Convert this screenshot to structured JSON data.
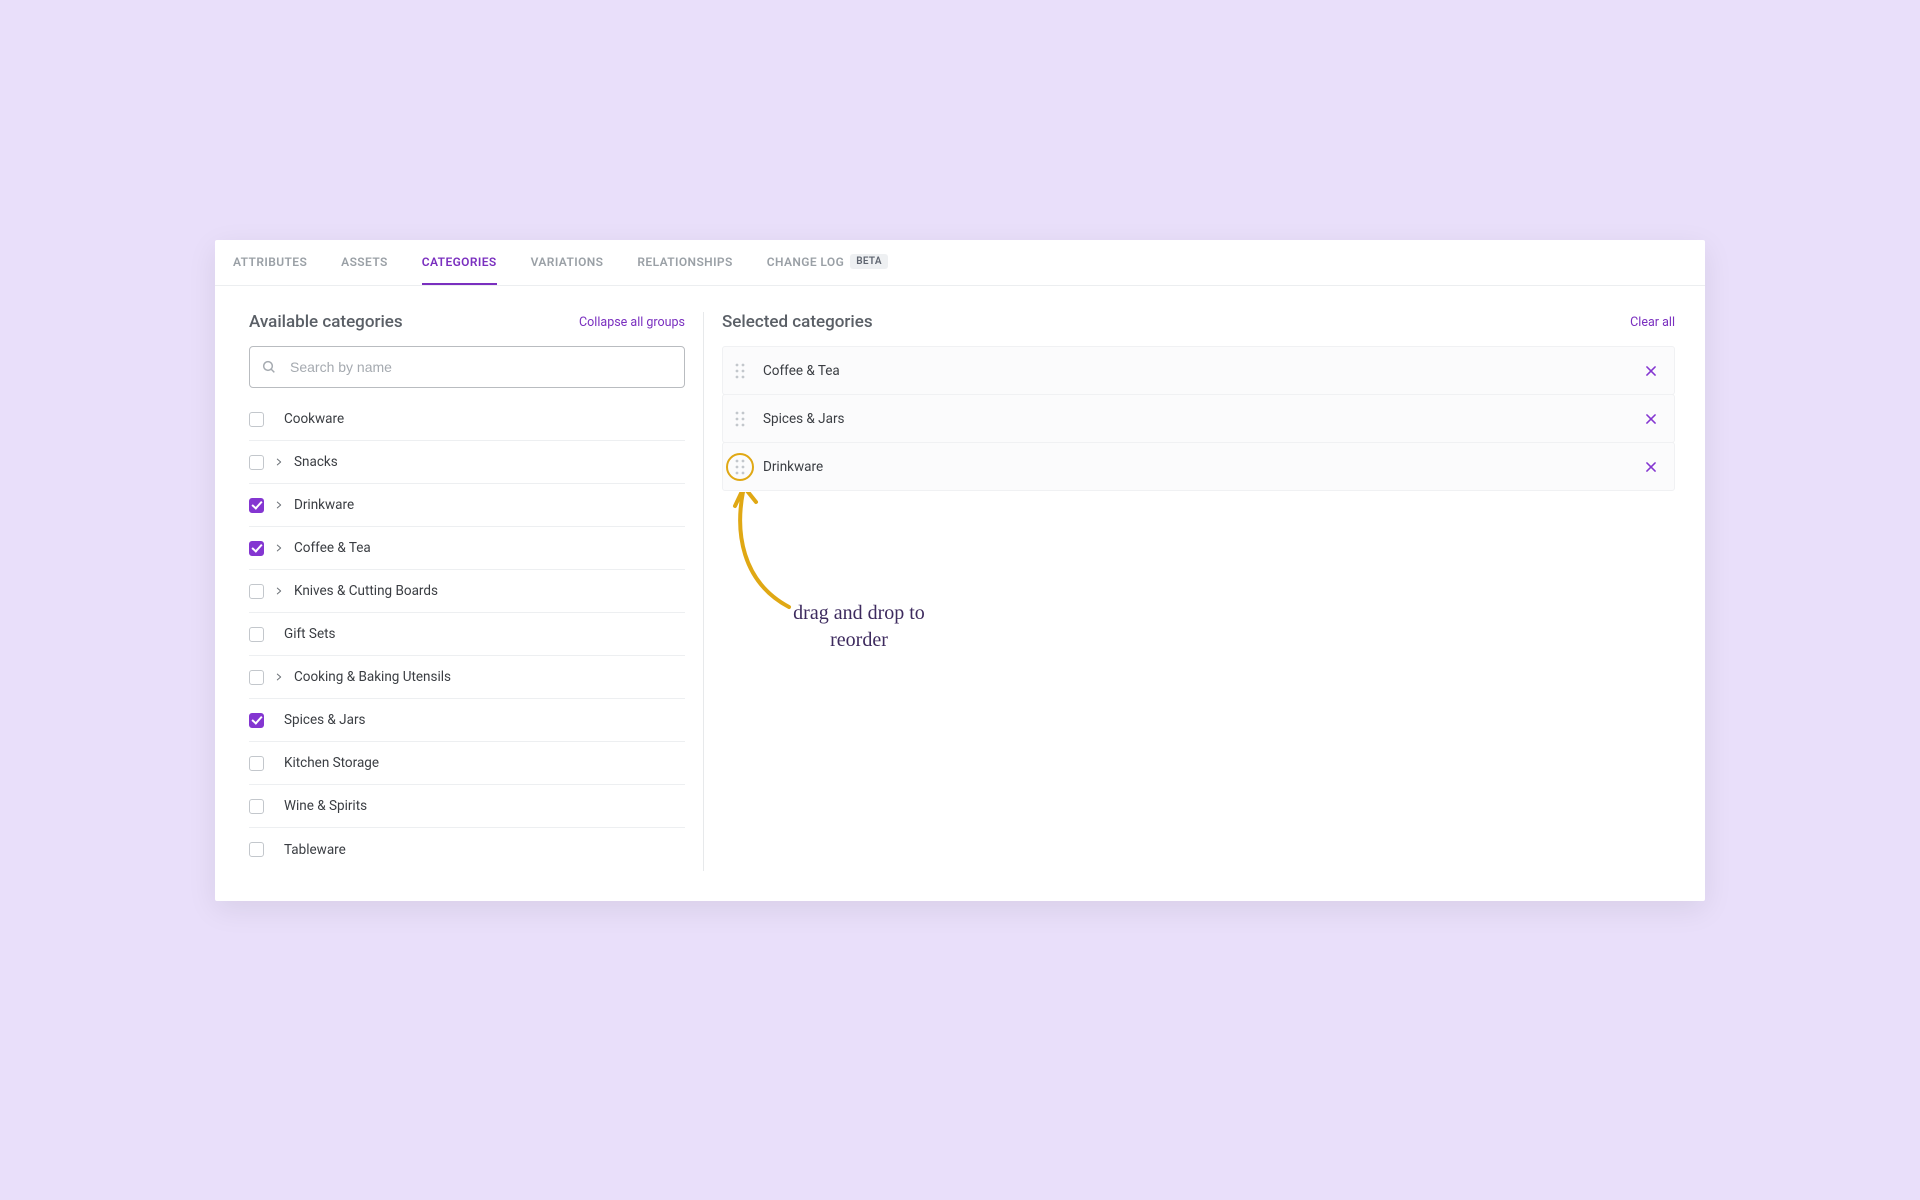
{
  "tabs": [
    {
      "label": "ATTRIBUTES",
      "active": false
    },
    {
      "label": "ASSETS",
      "active": false
    },
    {
      "label": "CATEGORIES",
      "active": true
    },
    {
      "label": "VARIATIONS",
      "active": false
    },
    {
      "label": "RELATIONSHIPS",
      "active": false
    },
    {
      "label": "CHANGE LOG",
      "active": false,
      "badge": "Beta"
    }
  ],
  "left": {
    "title": "Available categories",
    "collapse_link": "Collapse all groups",
    "search_placeholder": "Search by name",
    "items": [
      {
        "label": "Cookware",
        "checked": false,
        "expandable": false
      },
      {
        "label": "Snacks",
        "checked": false,
        "expandable": true
      },
      {
        "label": "Drinkware",
        "checked": true,
        "expandable": true
      },
      {
        "label": "Coffee & Tea",
        "checked": true,
        "expandable": true
      },
      {
        "label": "Knives & Cutting Boards",
        "checked": false,
        "expandable": true
      },
      {
        "label": "Gift Sets",
        "checked": false,
        "expandable": false
      },
      {
        "label": "Cooking & Baking Utensils",
        "checked": false,
        "expandable": true
      },
      {
        "label": "Spices & Jars",
        "checked": true,
        "expandable": false
      },
      {
        "label": "Kitchen Storage",
        "checked": false,
        "expandable": false
      },
      {
        "label": "Wine & Spirits",
        "checked": false,
        "expandable": false
      },
      {
        "label": "Tableware",
        "checked": false,
        "expandable": false
      }
    ]
  },
  "right": {
    "title": "Selected categories",
    "clear_link": "Clear all",
    "items": [
      {
        "label": "Coffee & Tea",
        "highlight": false
      },
      {
        "label": "Spices & Jars",
        "highlight": false
      },
      {
        "label": "Drinkware",
        "highlight": true
      }
    ]
  },
  "annotation": {
    "text": "drag and drop to reorder"
  }
}
